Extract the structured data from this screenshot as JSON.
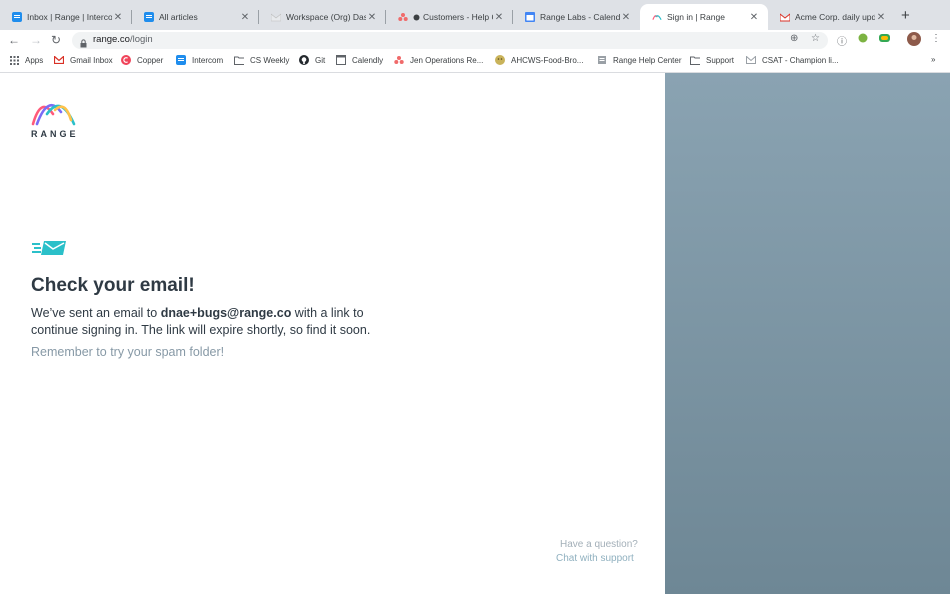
{
  "browser": {
    "tabs": [
      {
        "title": "Inbox | Range | Intercom",
        "icon": "intercom-icon",
        "active": false
      },
      {
        "title": "All articles",
        "icon": "intercom-icon",
        "active": false
      },
      {
        "title": "Workspace (Org) Dashb",
        "icon": "gmail-icon",
        "active": false
      },
      {
        "title": "Customers - Help Ce",
        "icon": "asana-icon",
        "active": false
      },
      {
        "title": "Range Labs - Calendar",
        "icon": "calendar-icon",
        "active": false
      },
      {
        "title": "Sign in | Range",
        "icon": "range-icon",
        "active": true
      },
      {
        "title": "Acme Corp. daily updat",
        "icon": "gmail-icon",
        "active": false
      }
    ],
    "new_tab_label": "+",
    "url_host": "range.co",
    "url_path": "/login",
    "bookmarks": [
      {
        "label": "Apps",
        "icon": "apps-grid-icon"
      },
      {
        "label": "Gmail Inbox",
        "icon": "gmail-icon"
      },
      {
        "label": "Copper",
        "icon": "copper-icon"
      },
      {
        "label": "Intercom",
        "icon": "intercom-icon"
      },
      {
        "label": "CS Weekly",
        "icon": "folder-icon"
      },
      {
        "label": "Git",
        "icon": "github-icon"
      },
      {
        "label": "Calendly",
        "icon": "calendly-icon"
      },
      {
        "label": "Jen Operations Re...",
        "icon": "asana-icon"
      },
      {
        "label": "AHCWS-Food-Bro...",
        "icon": "emoji-icon"
      },
      {
        "label": "Range Help Center",
        "icon": "page-icon"
      },
      {
        "label": "Support",
        "icon": "folder-icon"
      },
      {
        "label": "CSAT - Champion li...",
        "icon": "gmail-icon"
      }
    ],
    "bookmarks_overflow": "»"
  },
  "page": {
    "logo_text": "RANGE",
    "heading": "Check your email!",
    "body_prefix": "We’ve sent an email to ",
    "email": "dnae+bugs@range.co",
    "body_suffix": " with a link to continue signing in. The link will expire shortly, so find it soon.",
    "spam_note": "Remember to try your spam folder!",
    "help_question": "Have a question?",
    "help_link": "Chat with support"
  },
  "colors": {
    "accent": "#2bc0c9",
    "heading": "#2f3a44",
    "muted": "#8799a6",
    "link": "#8fb0bf",
    "side_panel": "#7d96a5"
  }
}
